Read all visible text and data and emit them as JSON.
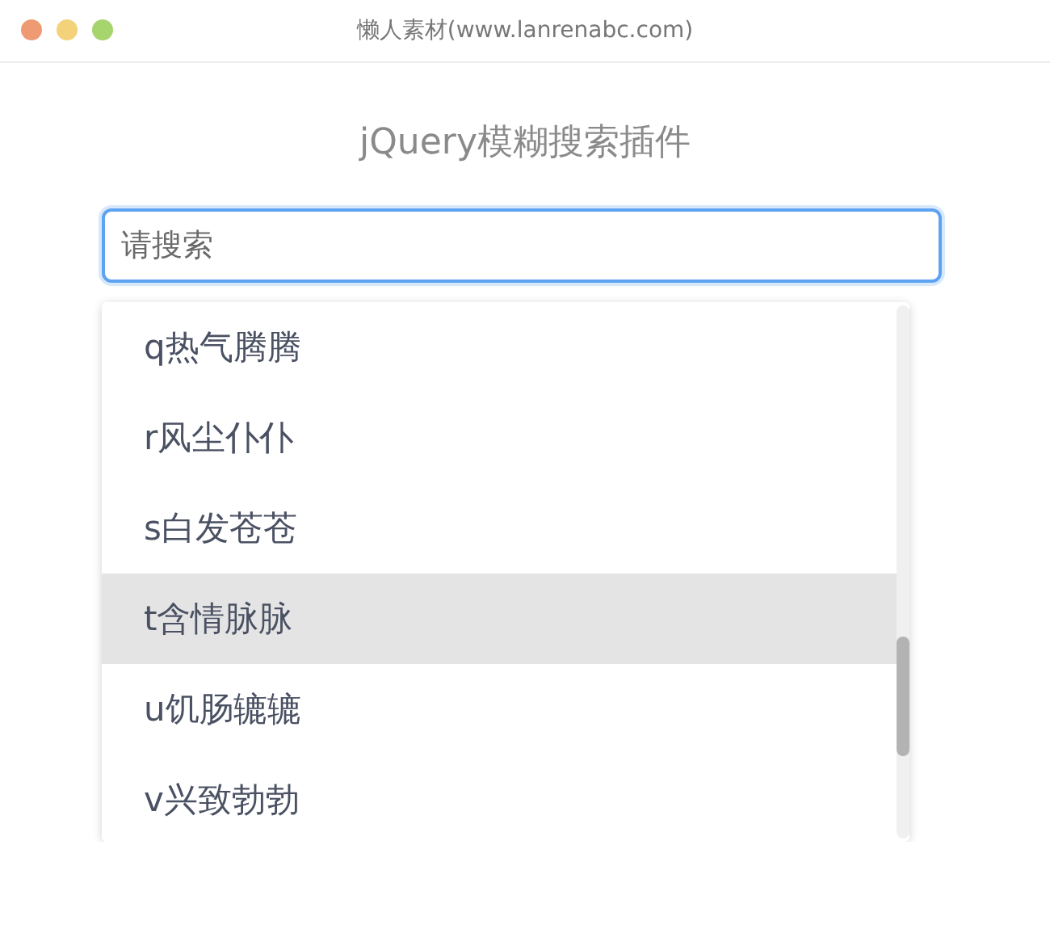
{
  "window": {
    "title": "懒人素材(www.lanrenabc.com)"
  },
  "heading": "jQuery模糊搜索插件",
  "search": {
    "placeholder": "请搜索"
  },
  "suggestions": [
    {
      "label": "q热气腾腾",
      "selected": false
    },
    {
      "label": "r风尘仆仆",
      "selected": false
    },
    {
      "label": "s白发苍苍",
      "selected": false
    },
    {
      "label": "t含情脉脉",
      "selected": true
    },
    {
      "label": "u饥肠辘辘",
      "selected": false
    },
    {
      "label": "v兴致勃勃",
      "selected": false
    }
  ]
}
